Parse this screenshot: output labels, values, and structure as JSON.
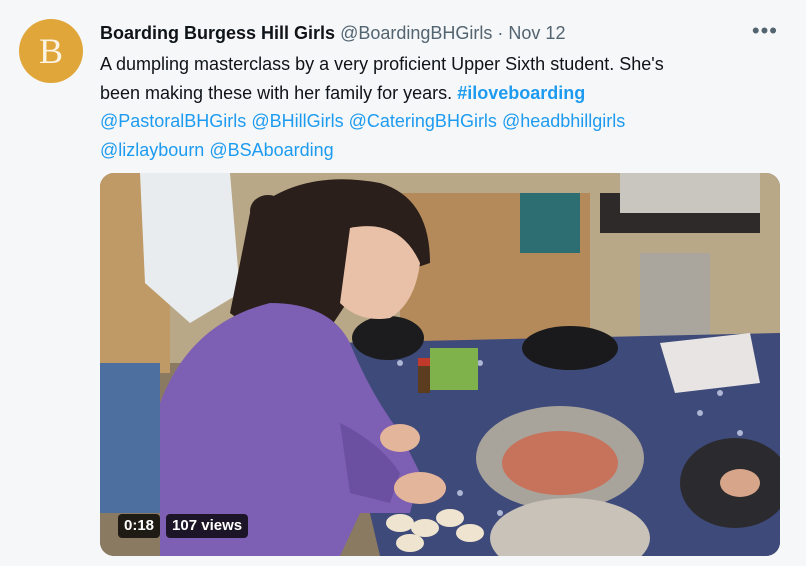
{
  "account": {
    "avatar_letter": "B",
    "name": "Boarding Burgess Hill Girls",
    "handle": "@BoardingBHGirls",
    "separator": "·",
    "date": "Nov 12"
  },
  "more_icon": "more-dots-icon",
  "tweet": {
    "line1": "A dumpling masterclass by a very proficient Upper Sixth student. She's",
    "line2_text": "been making these with her family for years.",
    "hashtag": "#iloveboarding",
    "mentions": [
      "@PastoralBHGirls",
      "@BHillGirls",
      "@CateringBHGirls",
      "@headbhillgirls",
      "@lizlaybourn",
      "@BSAboarding"
    ]
  },
  "video": {
    "duration": "0:18",
    "views": "107 views"
  },
  "colors": {
    "avatar_bg": "#e0a63a",
    "link": "#1d9bf0",
    "muted": "#536471"
  }
}
